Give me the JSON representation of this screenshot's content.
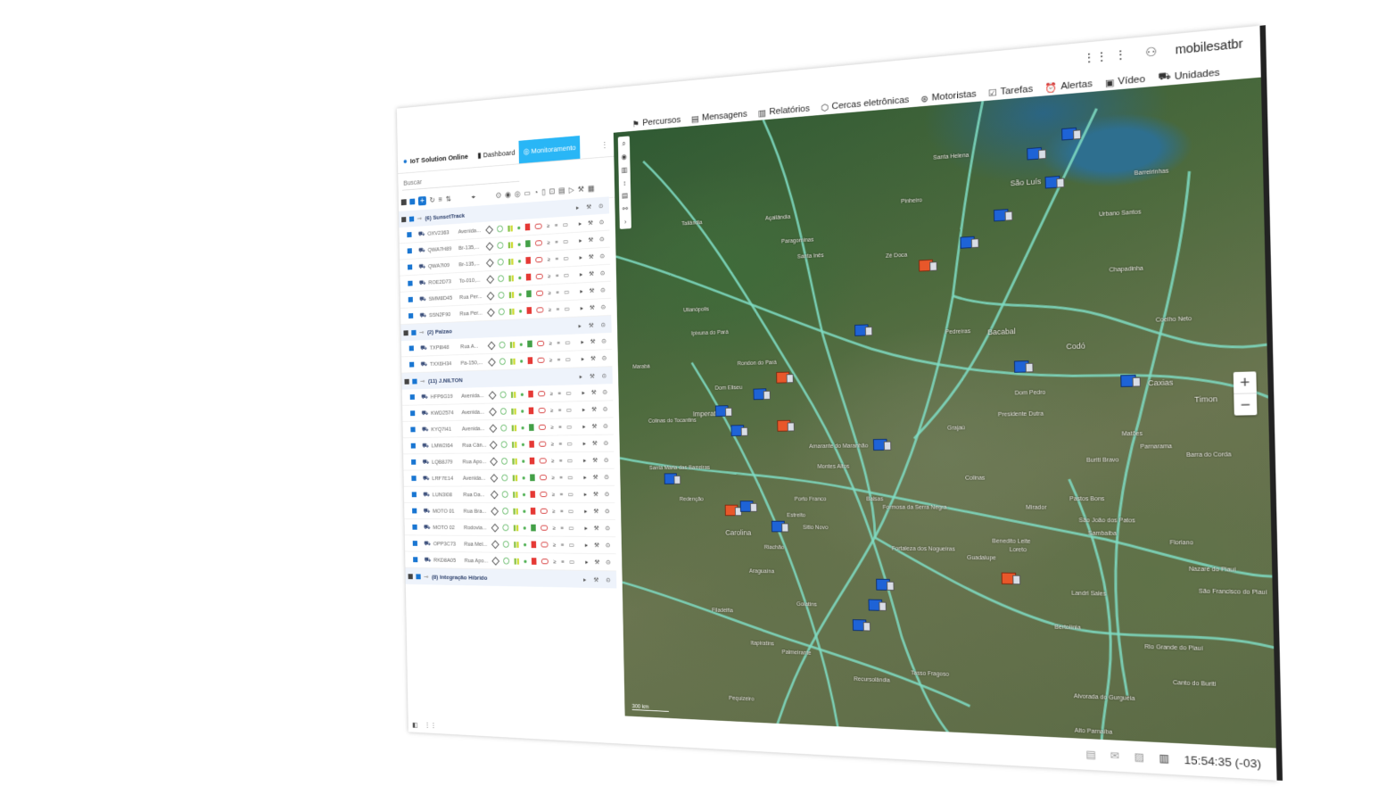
{
  "app": {
    "title": "IoT Solution Online",
    "user": "mobilesatbr"
  },
  "nav": [
    {
      "label": "Dashboard",
      "icon": "chart-icon"
    },
    {
      "label": "Monitoramento",
      "icon": "globe-icon",
      "active": true
    },
    {
      "label": "Percursos",
      "icon": "route-icon"
    },
    {
      "label": "Mensagens",
      "icon": "message-icon"
    },
    {
      "label": "Relatórios",
      "icon": "report-icon"
    },
    {
      "label": "Cercas eletrônicas",
      "icon": "fence-icon"
    },
    {
      "label": "Motoristas",
      "icon": "steering-icon"
    },
    {
      "label": "Tarefas",
      "icon": "task-icon"
    },
    {
      "label": "Alertas",
      "icon": "alarm-icon"
    },
    {
      "label": "Vídeo",
      "icon": "video-icon"
    },
    {
      "label": "Unidades",
      "icon": "truck-icon"
    }
  ],
  "topnav_labels": {
    "n0": "Percursos",
    "n1": "Mensagens",
    "n2": "Relatórios",
    "n3": "Cercas eletrônicas",
    "n4": "Motoristas",
    "n5": "Tarefas",
    "n6": "Alertas",
    "n7": "Vídeo",
    "n8": "Unidades"
  },
  "panel": {
    "tabs": {
      "dashboard": "Dashboard",
      "monitoring": "Monitoramento"
    },
    "search_placeholder": "Buscar",
    "groups": [
      {
        "name": "(6) SunsetTrack",
        "units": [
          {
            "plate": "OXV2363",
            "address": "Avenida..."
          },
          {
            "plate": "QWA7H89",
            "address": "Br-135,..."
          },
          {
            "plate": "QWA7I09",
            "address": "Br-135,..."
          },
          {
            "plate": "ROE2D73",
            "address": "To-010,..."
          },
          {
            "plate": "SMM8D45",
            "address": "Rua Per..."
          },
          {
            "plate": "SSN2F90",
            "address": "Rua Per..."
          }
        ]
      },
      {
        "name": "(2) Palzao",
        "units": [
          {
            "plate": "TXP8I48",
            "address": "Rua A..."
          },
          {
            "plate": "TXX6H34",
            "address": "Pa-150,..."
          }
        ]
      },
      {
        "name": "(11) J.NILTON",
        "units": [
          {
            "plate": "HFP6G19",
            "address": "Avenida..."
          },
          {
            "plate": "KWD2574",
            "address": "Avenida..."
          },
          {
            "plate": "KYQ7I41",
            "address": "Avenida..."
          },
          {
            "plate": "LMW2I64",
            "address": "Rua Cân..."
          },
          {
            "plate": "LQB8J79",
            "address": "Rua Apo..."
          },
          {
            "plate": "LRF7E14",
            "address": "Avenida..."
          },
          {
            "plate": "LUN3I08",
            "address": "Rua Da..."
          },
          {
            "plate": "MOTO 01",
            "address": "Rua Bra..."
          },
          {
            "plate": "MOTO 02",
            "address": "Rodovia..."
          },
          {
            "plate": "OPP3C73",
            "address": "Rua Mel..."
          },
          {
            "plate": "RKD8A05",
            "address": "Rua Apo..."
          }
        ]
      },
      {
        "name": "(8) Integração Híbrido",
        "units": []
      }
    ]
  },
  "map": {
    "cities": [
      "São Luís",
      "Barreirinhas",
      "Urbano Santos",
      "Chapadinha",
      "Coelho Neto",
      "Caxias",
      "Timon",
      "Codó",
      "Bacabal",
      "Pedreiras",
      "Presidente Dutra",
      "Dom Pedro",
      "Matões",
      "Parnarama",
      "Barra do Corda",
      "Grajaú",
      "Imperatriz",
      "Açailândia",
      "Santa Inês",
      "Balsas",
      "Carolina",
      "Riachão",
      "Tasso Fragoso",
      "Alto Parnaíba",
      "Colinas",
      "Mirador",
      "Pastos Bons",
      "São João dos Patos",
      "Buriti Bravo",
      "Floriano",
      "Nazaré do Piauí",
      "São Francisco do Piauí",
      "Landri Sales",
      "Bertolínia",
      "Rio Grande do Piauí",
      "Alvorada do Gurguéia",
      "Canto do Buriti",
      "Santa Helena",
      "Pinheiro",
      "Zé Doca",
      "Araguaína",
      "Sitio Novo",
      "Amarante do Maranhão",
      "Montes Altos",
      "Porto Franco",
      "Estreito",
      "Formosa da Serra Negra",
      "Fortaleza dos Nogueiras",
      "Loreto",
      "Sambaíba",
      "Benedito Leite",
      "Guadalupe",
      "Goiatins",
      "Recursolândia",
      "Filadélfia",
      "Palmeirante",
      "Colinas do Tocantins",
      "Pequizeiro",
      "Itapiratins",
      "Paragominas",
      "Tailândia",
      "Ipixuna do Pará",
      "Rondon do Pará",
      "Dom Eliseu",
      "Ulianópolis",
      "Marabá",
      "Santa Maria das Barreiras",
      "Redenção"
    ],
    "zoom_in": "+",
    "zoom_out": "−",
    "scale_label": "300 km"
  },
  "status": {
    "time": "15:54:35 (-03)"
  }
}
